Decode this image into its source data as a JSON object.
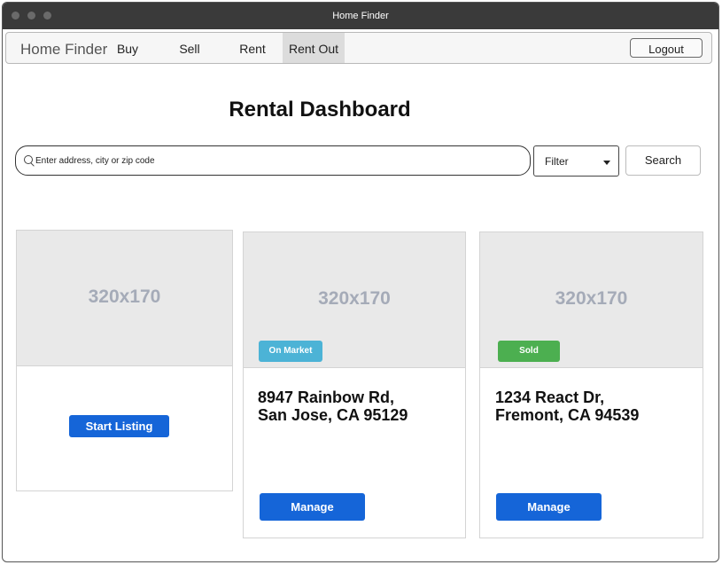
{
  "window": {
    "title": "Home Finder"
  },
  "navbar": {
    "brand": "Home Finder",
    "items": [
      {
        "label": "Buy",
        "active": false
      },
      {
        "label": "Sell",
        "active": false
      },
      {
        "label": "Rent",
        "active": false
      },
      {
        "label": "Rent Out",
        "active": true
      }
    ],
    "logout_label": "Logout"
  },
  "page": {
    "title": "Rental Dashboard"
  },
  "search": {
    "placeholder": "Enter address, city or zip code",
    "value": "",
    "filter_label": "Filter",
    "search_label": "Search"
  },
  "cards": [
    {
      "image_label": "320x170",
      "action_label": "Start Listing"
    },
    {
      "image_label": "320x170",
      "badge": "On Market",
      "badge_color": "#4cb3d6",
      "address_line1": "8947 Rainbow Rd,",
      "address_line2": "San Jose, CA 95129",
      "action_label": "Manage"
    },
    {
      "image_label": "320x170",
      "badge": "Sold",
      "badge_color": "#4caf50",
      "address_line1": "1234 React Dr,",
      "address_line2": "Fremont, CA 94539",
      "action_label": "Manage"
    }
  ],
  "colors": {
    "accent": "#1565d8",
    "titlebar": "#3a3a3a",
    "placeholder_text": "#a5abb8"
  }
}
